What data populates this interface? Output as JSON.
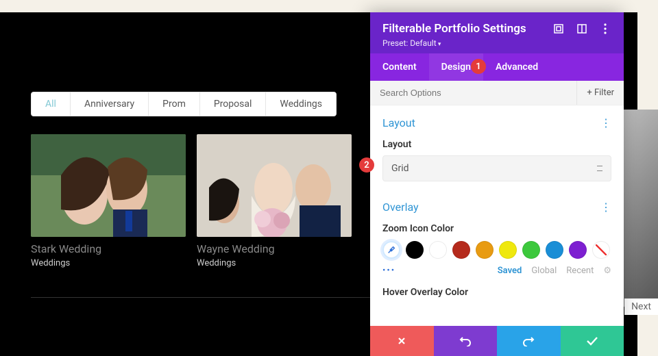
{
  "filters": [
    "All",
    "Anniversary",
    "Prom",
    "Proposal",
    "Weddings"
  ],
  "active_filter": 0,
  "cards": [
    {
      "title": "Stark Wedding",
      "category": "Weddings"
    },
    {
      "title": "Wayne Wedding",
      "category": "Weddings"
    }
  ],
  "next_label": "Next",
  "panel": {
    "title": "Filterable Portfolio Settings",
    "preset": "Preset: Default",
    "tabs": [
      "Content",
      "Design",
      "Advanced"
    ],
    "active_tab": 1,
    "search_placeholder": "Search Options",
    "filter_btn": "Filter",
    "sections": {
      "layout": {
        "heading": "Layout",
        "field_label": "Layout",
        "value": "Grid"
      },
      "overlay": {
        "heading": "Overlay",
        "zoom_label": "Zoom Icon Color",
        "hover_label": "Hover Overlay Color"
      }
    },
    "swatch_colors": [
      "#000000",
      "#ffffff",
      "#b52a1c",
      "#e89b12",
      "#efe80e",
      "#3cc83c",
      "#1a8ed6",
      "#7d1fd1"
    ],
    "saved_tabs": {
      "saved": "Saved",
      "global": "Global",
      "recent": "Recent"
    }
  },
  "badges": {
    "b1": "1",
    "b2": "2"
  }
}
